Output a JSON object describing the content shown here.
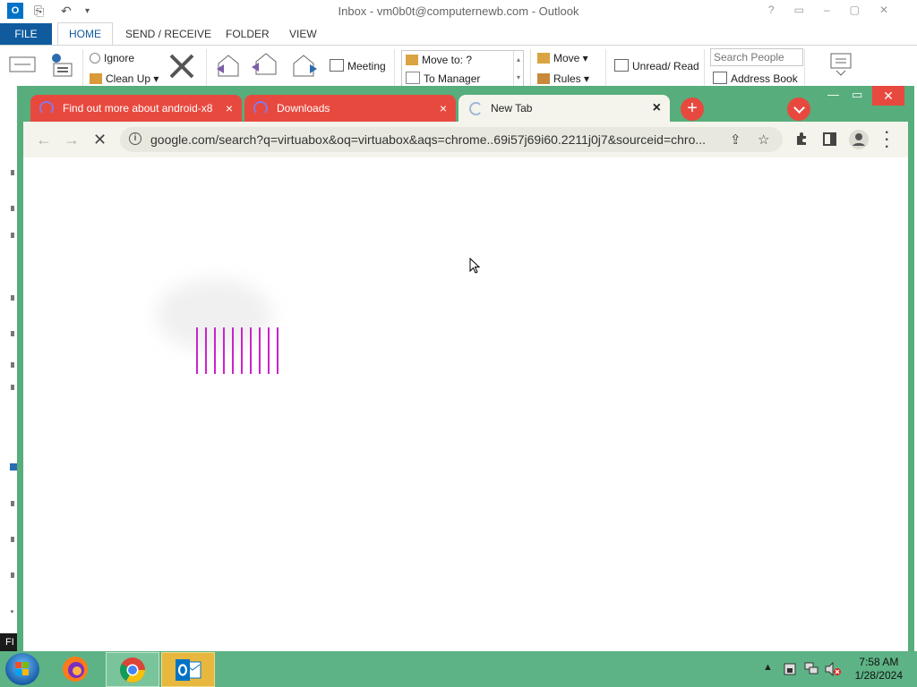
{
  "outlook": {
    "title": "Inbox - vm0b0t@computernewb.com - Outlook",
    "tabs": {
      "file": "FILE",
      "home": "HOME",
      "send_receive": "SEND / RECEIVE",
      "folder": "FOLDER",
      "view": "VIEW"
    },
    "ribbon": {
      "ignore": "Ignore",
      "clean_up": "Clean Up",
      "meeting": "Meeting",
      "move_to": "Move to: ?",
      "to_manager": "To Manager",
      "move": "Move",
      "rules": "Rules",
      "unread_read": "Unread/ Read",
      "search_people_placeholder": "Search People",
      "address_book": "Address Book"
    },
    "left_label": "FI"
  },
  "browser": {
    "tabs": [
      {
        "label": "Find out more about android-x8",
        "close": "×"
      },
      {
        "label": "Downloads",
        "close": "×"
      },
      {
        "label": "New Tab",
        "close": "×"
      }
    ],
    "new_tab": "+",
    "address_url": "google.com/search?q=virtuabox&oq=virtuabox&aqs=chrome..69i57j69i60.2211j0j7&sourceid=chro...",
    "page_state": "loading"
  },
  "taskbar": {
    "time": "7:58 AM",
    "date": "1/28/2024"
  },
  "colors": {
    "chrome_frame": "#57ad7b",
    "tab_red": "#e8493f",
    "toolbar_bg": "#f4f4ec",
    "taskbar": "#5db385",
    "loading_bars": "#cc22cc",
    "outlook_blue": "#0f5b9e"
  }
}
